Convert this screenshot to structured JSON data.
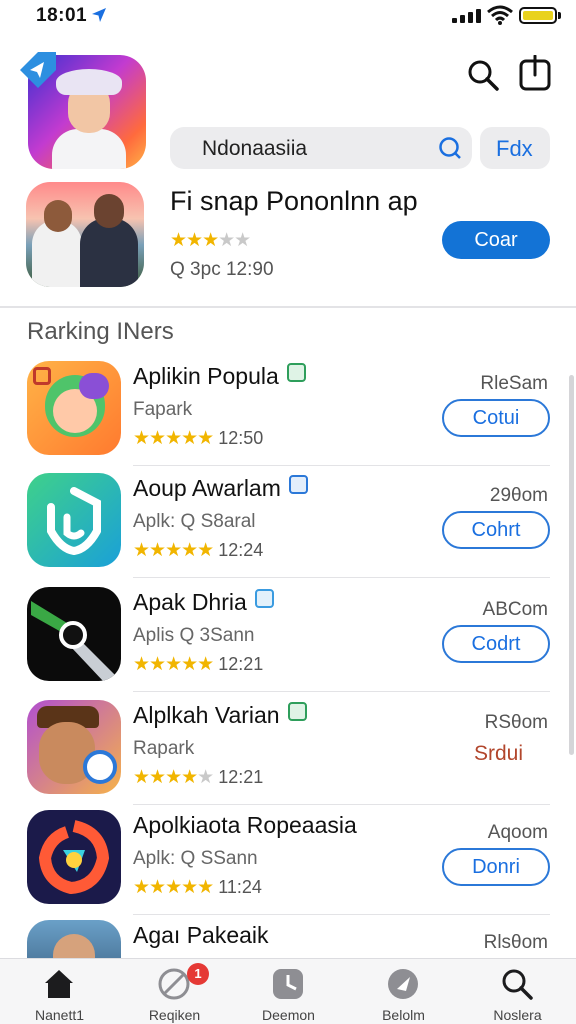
{
  "status_bar": {
    "time": "18:01"
  },
  "header": {
    "search_value": "Ndonaasiia",
    "filter_label": "Fdx"
  },
  "featured": {
    "title": "Fi snap Pononlnn ap",
    "rating_stars": "★★★",
    "meta": "Q 3pc 12:90",
    "button_label": "Coar"
  },
  "section_title": "Rarking INers",
  "list": [
    {
      "title": "Aplikin Popula",
      "subtitle": "Fapark",
      "stars": "★★★★★",
      "time": "12:50",
      "right_text": "RleSam",
      "button_label": "Cotui",
      "badge_color": "#2e9e5b"
    },
    {
      "title": "Aoup Awarlam",
      "subtitle": "Aplk: Q S8aral",
      "stars": "★★★★★",
      "time": "12:24",
      "right_text": "29θom",
      "button_label": "Cohrt",
      "badge_color": "#2b78d8"
    },
    {
      "title": "Apak Dhria",
      "subtitle": "Aplis Q 3Sann",
      "stars": "★★★★★",
      "time": "12:21",
      "right_text": "ABCom",
      "button_label": "Codrt",
      "badge_color": "#3a9be0"
    },
    {
      "title": "Alplkah Varian",
      "subtitle": "Rapark",
      "stars": "★★★★",
      "time": "12:21",
      "right_text": "RSθom",
      "link_label": "Srdui",
      "badge_color": "#2e9e5b"
    },
    {
      "title": "Apolkiaota Ropeaasia",
      "subtitle": "Aplk: Q SSann",
      "stars": "★★★★★",
      "time": "11:24",
      "right_text": "Aqoom",
      "button_label": "Donri",
      "badge_color": ""
    },
    {
      "title": "Agaı Pakeaik",
      "subtitle": "",
      "stars": "",
      "time": "",
      "right_text": "Rlsθom",
      "badge_color": ""
    }
  ],
  "tabs": [
    {
      "label": "Nanett1",
      "icon": "home-icon"
    },
    {
      "label": "Reqiken",
      "icon": "compass-icon",
      "badge": "1"
    },
    {
      "label": "Deemon",
      "icon": "clock-icon"
    },
    {
      "label": "Belolm",
      "icon": "play-icon"
    },
    {
      "label": "Noslera",
      "icon": "search-icon"
    }
  ]
}
